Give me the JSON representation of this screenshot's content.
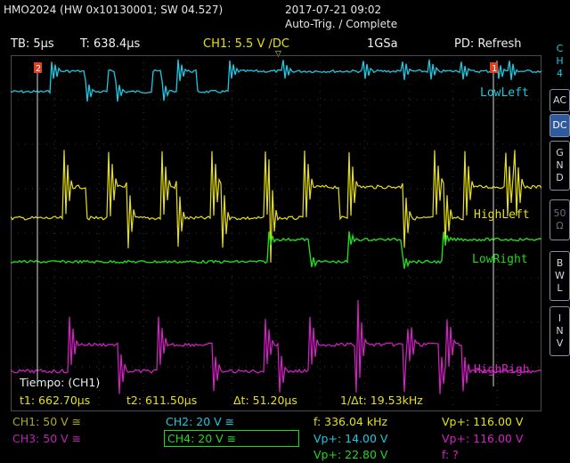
{
  "header": {
    "device": "HMO2024 (HW 0x10130001; SW 04.527)",
    "datetime": "2017-07-21 09:02",
    "status": "Auto-Trig. / Complete"
  },
  "settings": {
    "timebase": "TB: 5µs",
    "trigger_time": "T: 638.4µs",
    "ch1": "CH1: 5.5 V ∕DC",
    "sample_rate": "1GSa",
    "mode": "PD: Refresh"
  },
  "side_menu": {
    "channel_letters": [
      "C",
      "H",
      "4"
    ],
    "ac": "AC",
    "dc": "DC",
    "gnd": [
      "G",
      "N",
      "D"
    ],
    "imp": [
      "50",
      "Ω"
    ],
    "bwl": [
      "B",
      "W",
      "L"
    ],
    "inv": [
      "I",
      "N",
      "V"
    ]
  },
  "traces": {
    "ch2": {
      "label": "LowLeft",
      "marker": "2",
      "color": "#1ec8e0"
    },
    "ch1": {
      "label": "HighLeft",
      "marker": "1",
      "color": "#e6e012"
    },
    "ch4": {
      "label": "LowRight",
      "marker": "4",
      "color": "#22d81e"
    },
    "ch3": {
      "label": "HighRigh",
      "marker": "3",
      "color": "#d820c8"
    }
  },
  "cursors": {
    "left_label": "2",
    "right_label": "1"
  },
  "measurement": {
    "title": "Tiempo: (CH1)",
    "t1": "t1: 662.70µs",
    "t2": "t2: 611.50µs",
    "dt": "Δt: 51.20µs",
    "inv_dt": "1/Δt: 19.53kHz"
  },
  "footer": {
    "ch1": "CH1: 50 V ≅",
    "ch2": "CH2: 20 V ≅",
    "ch3": "CH3: 50 V ≅",
    "ch4": "CH4: 20 V ≅",
    "freq": "f: 336.04 kHz",
    "vp1": "Vp+: 14.00 V",
    "vp2": "Vp+: 22.80 V",
    "vp3": "Vp+: 116.00 V",
    "vp4": "Vp+: 116.00 V",
    "f2": "f: ?"
  },
  "colors": {
    "ch1": "#e6e012",
    "ch2": "#1ec8e0",
    "ch3": "#d820c8",
    "ch4": "#22d81e",
    "accent": "#2f5a9e"
  }
}
